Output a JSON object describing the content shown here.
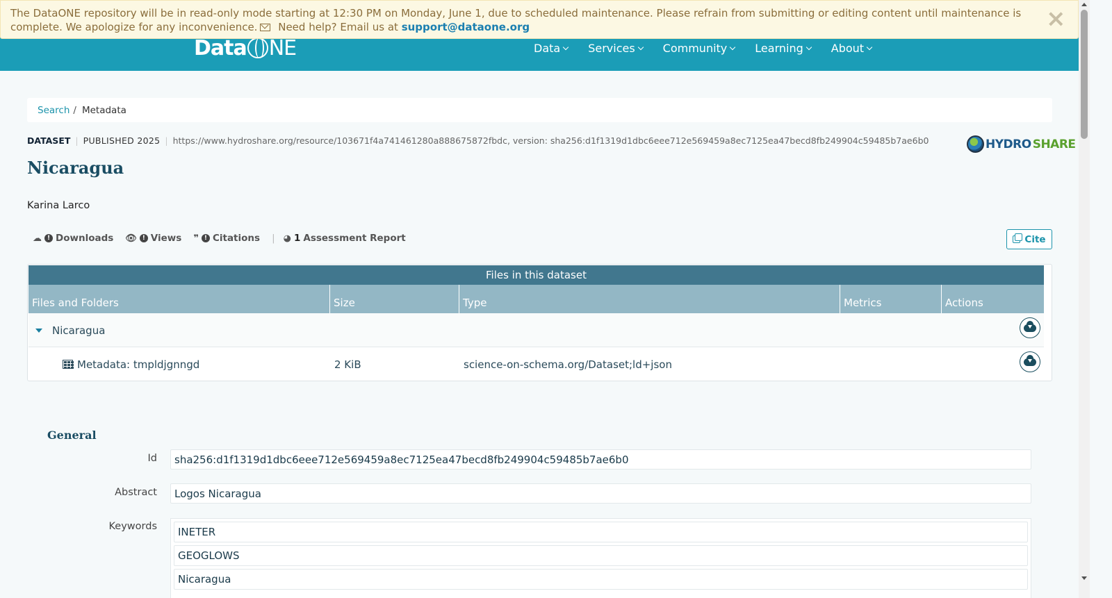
{
  "banner": {
    "message": "The DataONE repository will be in read-only mode starting at 12:30 PM on Monday, June 1, due to scheduled maintenance. Please refrain from submitting or editing content until maintenance is complete. We apologize for any inconvenience.",
    "help_text": "Need help? Email us at",
    "email": "support@dataone.org",
    "close": "×"
  },
  "nav": {
    "logo_a": "Data",
    "logo_b": "NE",
    "items": [
      {
        "label": "Data"
      },
      {
        "label": "Services"
      },
      {
        "label": "Community"
      },
      {
        "label": "Learning"
      },
      {
        "label": "About"
      }
    ]
  },
  "breadcrumb": {
    "search": "Search",
    "sep": "/",
    "current": "Metadata"
  },
  "dataset": {
    "type": "DATASET",
    "published": "PUBLISHED 2025",
    "identifier": "https://www.hydroshare.org/resource/103671f4a741461280a888675872fbdc, version: sha256:d1f1319d1dbc6eee712e569459a8ec7125ea47becd8fb249904c59485b7ae6b0",
    "repo_logo_a": "HYDRO",
    "repo_logo_b": "SHARE",
    "title": "Nicaragua",
    "author": "Karina Larco"
  },
  "metrics": {
    "downloads": "Downloads",
    "views": "Views",
    "citations": "Citations",
    "assessment_count": "1",
    "assessment": "Assessment Report",
    "divider": "|"
  },
  "cite_label": "Cite",
  "files": {
    "header": "Files in this dataset",
    "columns": [
      "Files and Folders",
      "Size",
      "Type",
      "Metrics",
      "Actions"
    ],
    "folder": "Nicaragua",
    "rows": [
      {
        "name": "Metadata: tmpldjgnngd",
        "size": "2 KiB",
        "type": "science-on-schema.org/Dataset;ld+json"
      }
    ]
  },
  "general": {
    "title": "General",
    "id_label": "Id",
    "id_value": "sha256:d1f1319d1dbc6eee712e569459a8ec7125ea47becd8fb249904c59485b7ae6b0",
    "abstract_label": "Abstract",
    "abstract_value": "Logos Nicaragua",
    "keywords_label": "Keywords",
    "keywords": [
      "INETER",
      "GEOGLOWS",
      "Nicaragua"
    ]
  },
  "colors": {
    "nav": "#1b9db7",
    "banner_bg": "#fcf8e3",
    "table_header": "#41778e",
    "column_header": "#93b7c5",
    "accent": "#1b93ab"
  }
}
